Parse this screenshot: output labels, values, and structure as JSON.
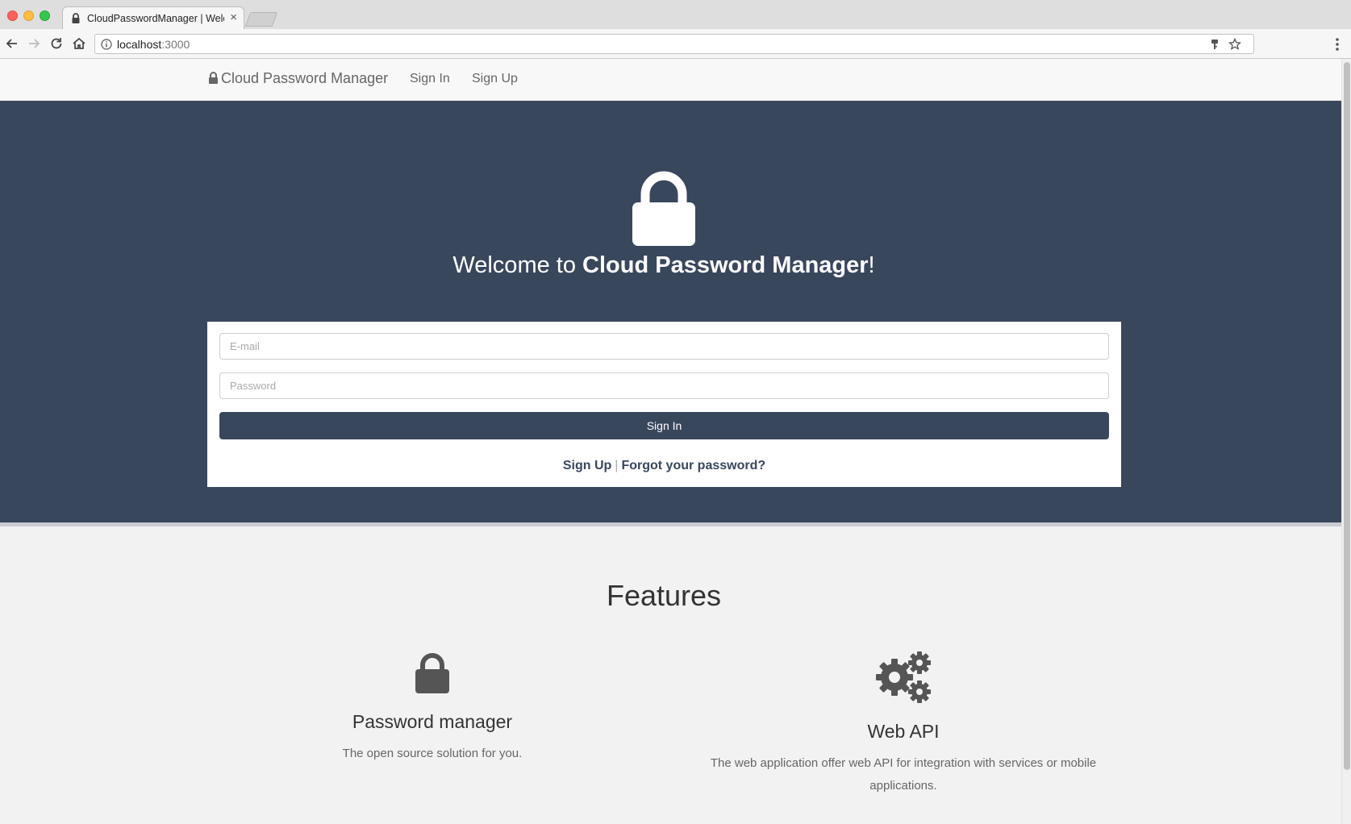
{
  "browser": {
    "tab_title": "CloudPasswordManager | Welcome",
    "url_host": "localhost",
    "url_port": ":3000"
  },
  "nav": {
    "brand": "Cloud Password Manager",
    "links": [
      "Sign In",
      "Sign Up"
    ]
  },
  "hero": {
    "welcome_prefix": "Welcome to ",
    "welcome_brand": "Cloud Password Manager",
    "welcome_suffix": "!"
  },
  "login": {
    "email_placeholder": "E-mail",
    "password_placeholder": "Password",
    "submit_label": "Sign In",
    "signup_link": "Sign Up",
    "separator": "|",
    "forgot_link": "Forgot your password?"
  },
  "features": {
    "title": "Features",
    "items": [
      {
        "icon": "lock-icon",
        "name": "Password manager",
        "description": "The open source solution for you."
      },
      {
        "icon": "gears-icon",
        "name": "Web API",
        "description": "The web application offer web API for integration with services or mobile applications."
      }
    ]
  },
  "colors": {
    "hero_bg": "#39475d",
    "page_bg": "#f2f2f2",
    "navbar_bg": "#f8f8f8"
  }
}
